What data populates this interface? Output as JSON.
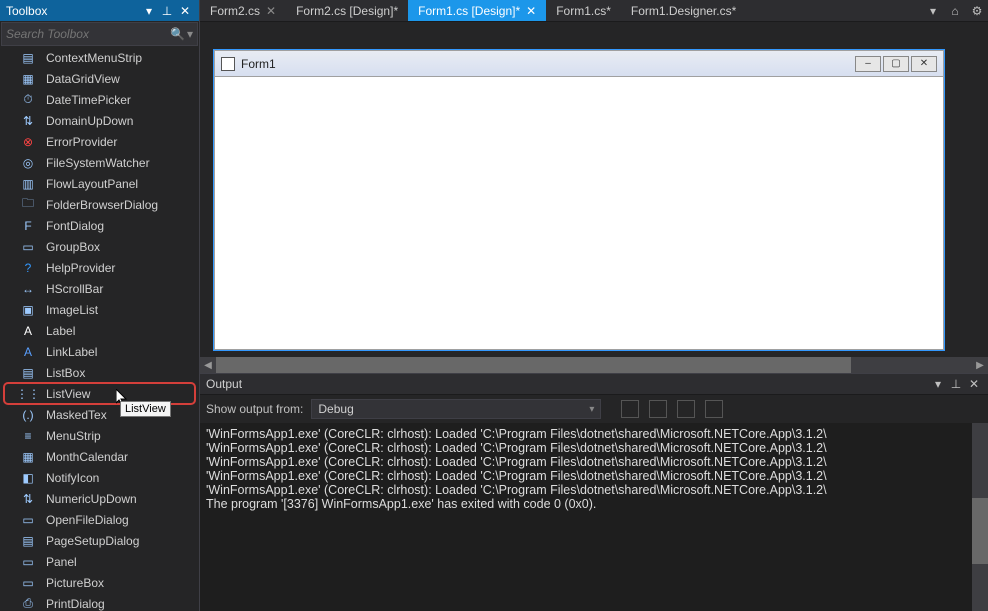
{
  "toolbox": {
    "title": "Toolbox",
    "search_placeholder": "Search Toolbox",
    "items": [
      {
        "label": "ContextMenuStrip",
        "icon": "context-menu-icon"
      },
      {
        "label": "DataGridView",
        "icon": "grid-icon"
      },
      {
        "label": "DateTimePicker",
        "icon": "datetime-icon"
      },
      {
        "label": "DomainUpDown",
        "icon": "updown-icon"
      },
      {
        "label": "ErrorProvider",
        "icon": "error-icon"
      },
      {
        "label": "FileSystemWatcher",
        "icon": "file-watcher-icon"
      },
      {
        "label": "FlowLayoutPanel",
        "icon": "flowlayout-icon"
      },
      {
        "label": "FolderBrowserDialog",
        "icon": "folder-icon"
      },
      {
        "label": "FontDialog",
        "icon": "font-icon"
      },
      {
        "label": "GroupBox",
        "icon": "groupbox-icon"
      },
      {
        "label": "HelpProvider",
        "icon": "help-icon"
      },
      {
        "label": "HScrollBar",
        "icon": "hscroll-icon"
      },
      {
        "label": "ImageList",
        "icon": "imagelist-icon"
      },
      {
        "label": "Label",
        "icon": "label-icon"
      },
      {
        "label": "LinkLabel",
        "icon": "linklabel-icon"
      },
      {
        "label": "ListBox",
        "icon": "listbox-icon"
      },
      {
        "label": "ListView",
        "icon": "listview-icon",
        "highlighted": true,
        "tooltip": "ListView",
        "cursor": true
      },
      {
        "label": "MaskedTex",
        "icon": "maskedtext-icon"
      },
      {
        "label": "MenuStrip",
        "icon": "menustrip-icon"
      },
      {
        "label": "MonthCalendar",
        "icon": "calendar-icon"
      },
      {
        "label": "NotifyIcon",
        "icon": "notify-icon"
      },
      {
        "label": "NumericUpDown",
        "icon": "numeric-icon"
      },
      {
        "label": "OpenFileDialog",
        "icon": "openfile-icon"
      },
      {
        "label": "PageSetupDialog",
        "icon": "pagesetup-icon"
      },
      {
        "label": "Panel",
        "icon": "panel-icon"
      },
      {
        "label": "PictureBox",
        "icon": "picture-icon"
      },
      {
        "label": "PrintDialog",
        "icon": "print-icon"
      }
    ]
  },
  "tabs": [
    {
      "label": "Form2.cs",
      "close": true
    },
    {
      "label": "Form2.cs [Design]*"
    },
    {
      "label": "Form1.cs [Design]*",
      "active": true,
      "close": true
    },
    {
      "label": "Form1.cs*"
    },
    {
      "label": "Form1.Designer.cs*"
    }
  ],
  "form": {
    "title": "Form1"
  },
  "output": {
    "title": "Output",
    "show_label": "Show output from:",
    "selected": "Debug",
    "lines": [
      "'WinFormsApp1.exe' (CoreCLR: clrhost): Loaded 'C:\\Program Files\\dotnet\\shared\\Microsoft.NETCore.App\\3.1.2\\",
      "'WinFormsApp1.exe' (CoreCLR: clrhost): Loaded 'C:\\Program Files\\dotnet\\shared\\Microsoft.NETCore.App\\3.1.2\\",
      "'WinFormsApp1.exe' (CoreCLR: clrhost): Loaded 'C:\\Program Files\\dotnet\\shared\\Microsoft.NETCore.App\\3.1.2\\",
      "'WinFormsApp1.exe' (CoreCLR: clrhost): Loaded 'C:\\Program Files\\dotnet\\shared\\Microsoft.NETCore.App\\3.1.2\\",
      "'WinFormsApp1.exe' (CoreCLR: clrhost): Loaded 'C:\\Program Files\\dotnet\\shared\\Microsoft.NETCore.App\\3.1.2\\",
      "The program '[3376] WinFormsApp1.exe' has exited with code 0 (0x0)."
    ]
  },
  "icon_glyphs": {
    "context-menu-icon": "▤",
    "grid-icon": "▦",
    "datetime-icon": "⏱",
    "updown-icon": "⇅",
    "error-icon": "⊗",
    "file-watcher-icon": "◎",
    "flowlayout-icon": "▥",
    "folder-icon": "🗀",
    "font-icon": "F",
    "groupbox-icon": "▭",
    "help-icon": "?",
    "hscroll-icon": "↔",
    "imagelist-icon": "▣",
    "label-icon": "A",
    "linklabel-icon": "A",
    "listbox-icon": "▤",
    "listview-icon": "⋮⋮",
    "maskedtext-icon": "(.)",
    "menustrip-icon": "≡",
    "calendar-icon": "▦",
    "notify-icon": "◧",
    "numeric-icon": "⇅",
    "openfile-icon": "▭",
    "pagesetup-icon": "▤",
    "panel-icon": "▭",
    "picture-icon": "▭",
    "print-icon": "⎙"
  },
  "icon_colors": {
    "error-icon": "#ff4444",
    "help-icon": "#3399ff",
    "label-icon": "#ffffff",
    "linklabel-icon": "#5aa0ff"
  }
}
